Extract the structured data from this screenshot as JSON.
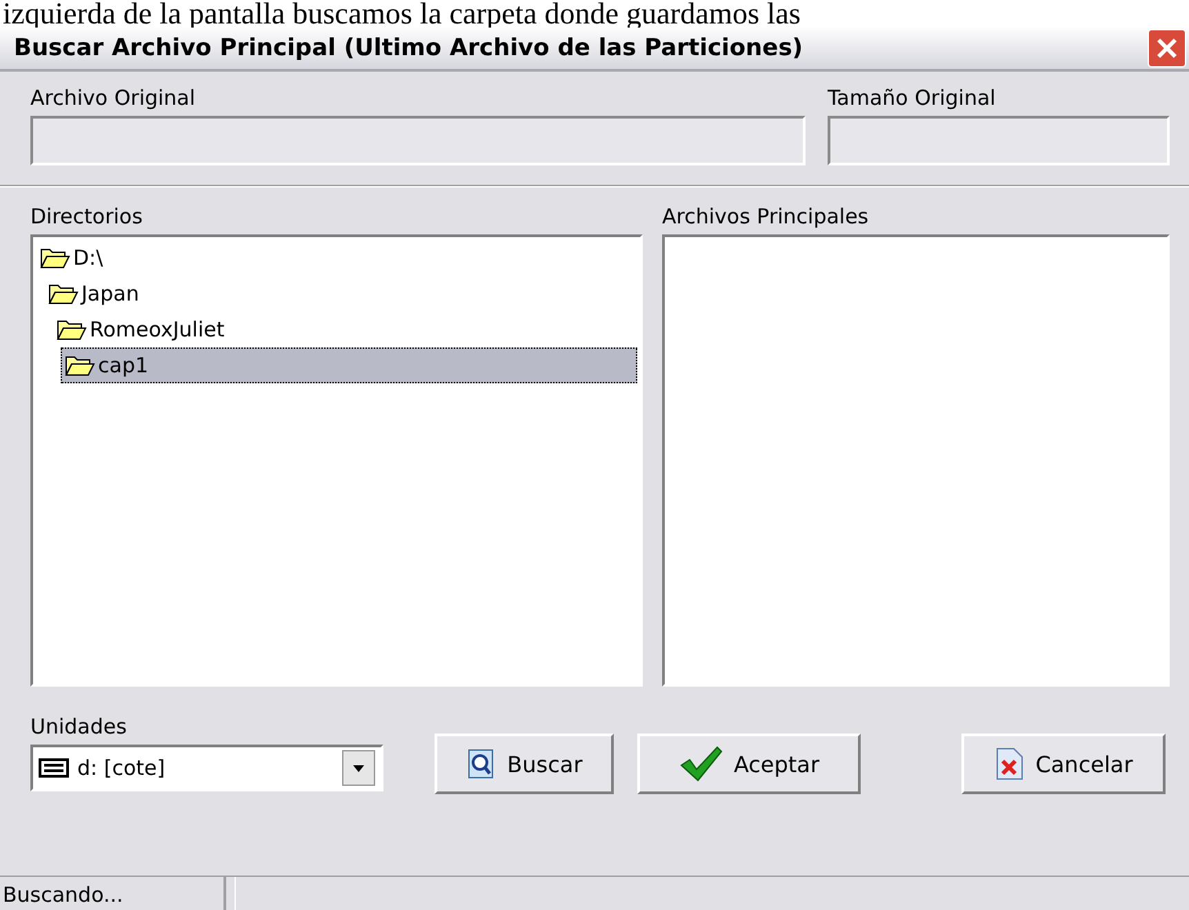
{
  "page_caption": "izquierda de la pantalla buscamos la carpeta donde guardamos las",
  "window": {
    "title": "Buscar Archivo Principal (Ultimo Archivo de las Particiones)"
  },
  "original_file": {
    "label": "Archivo Original"
  },
  "original_size": {
    "label": "Tamaño Original"
  },
  "directories": {
    "label": "Directorios",
    "tree": [
      {
        "name": "D:\\",
        "selected": false,
        "children": [
          {
            "name": "Japan",
            "selected": false,
            "children": [
              {
                "name": "RomeoxJuliet",
                "selected": false,
                "children": [
                  {
                    "name": "cap1",
                    "selected": true
                  }
                ]
              }
            ]
          }
        ]
      }
    ]
  },
  "main_files": {
    "label": "Archivos Principales"
  },
  "drives": {
    "label": "Unidades",
    "value": "d: [cote]"
  },
  "buttons": [
    {
      "kind": "search",
      "label": "Buscar"
    },
    {
      "kind": "accept",
      "label": "Aceptar"
    },
    {
      "kind": "cancel",
      "label": "Cancelar"
    }
  ],
  "status_bar": {
    "text": "Buscando..."
  }
}
